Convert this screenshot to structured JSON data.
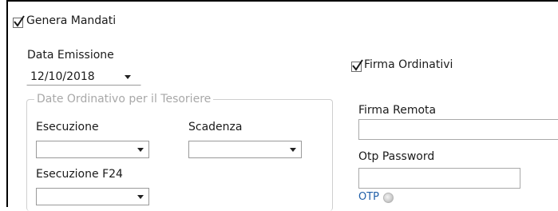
{
  "genera_mandati": {
    "label": "Genera Mandati",
    "checked": true
  },
  "data_emissione": {
    "label": "Data Emissione",
    "value": "12/10/2018"
  },
  "firma_ordinativi": {
    "label": "Firma Ordinativi",
    "checked": true
  },
  "date_ordinativo": {
    "legend": "Date Ordinativo per il Tesoriere",
    "esecuzione": {
      "label": "Esecuzione",
      "value": ""
    },
    "scadenza": {
      "label": "Scadenza",
      "value": ""
    },
    "esecuzione_f24": {
      "label": "Esecuzione F24",
      "value": ""
    }
  },
  "firma_remota": {
    "label": "Firma Remota",
    "value": ""
  },
  "otp_password": {
    "label": "Otp Password",
    "value": ""
  },
  "otp_link": {
    "label": "OTP"
  }
}
